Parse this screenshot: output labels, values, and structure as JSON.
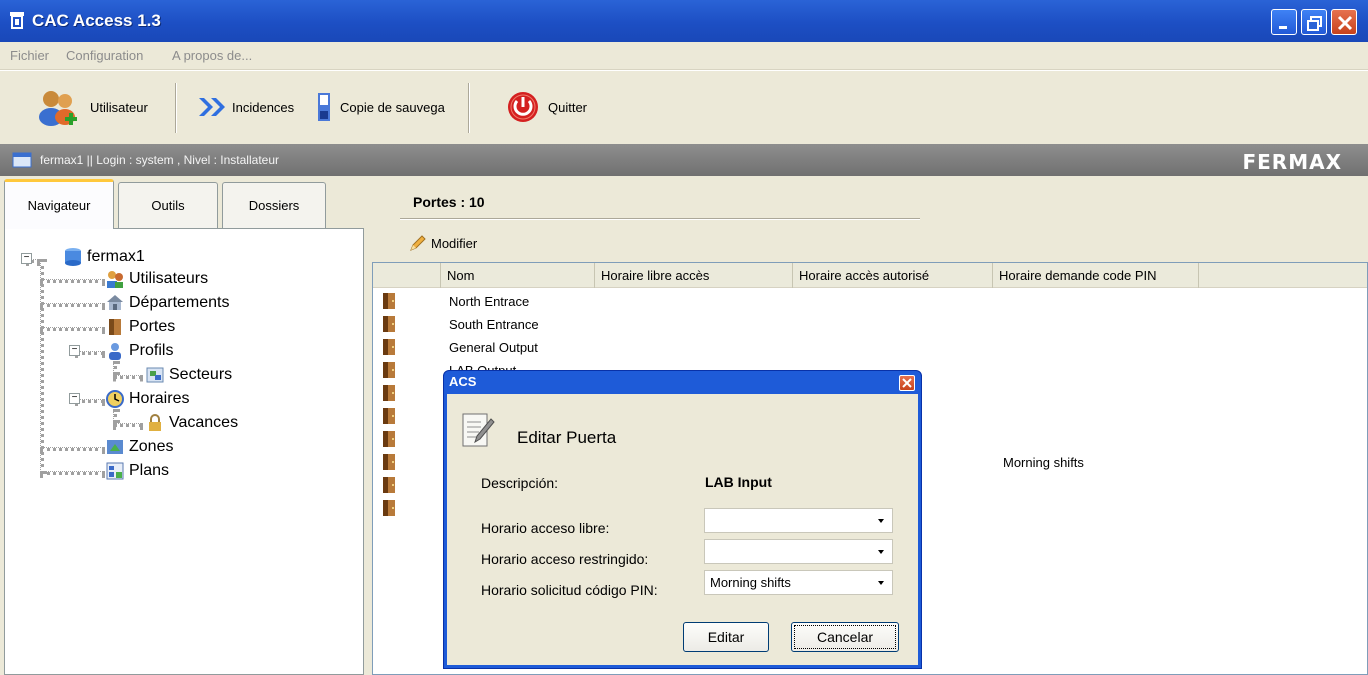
{
  "window": {
    "title": "CAC Access 1.3"
  },
  "menu": [
    "Fichier",
    "Configuration",
    "A propos de..."
  ],
  "toolbar": {
    "utilisateur": "Utilisateur",
    "incidences": "Incidences",
    "copie": "Copie de sauvega",
    "quitter": "Quitter"
  },
  "infobar": {
    "text": "fermax1  || Login : system , Nivel : Installateur",
    "brand": "FERMAX"
  },
  "tabs": [
    "Navigateur",
    "Outils",
    "Dossiers"
  ],
  "tree": {
    "root": "fermax1",
    "utilisateurs": "Utilisateurs",
    "departements": "Départements",
    "portes": "Portes",
    "profils": "Profils",
    "secteurs": "Secteurs",
    "horaires": "Horaires",
    "vacances": "Vacances",
    "zones": "Zones",
    "plans": "Plans"
  },
  "main": {
    "title": "Portes : 10",
    "modifier": "Modifier",
    "columns": [
      "Nom",
      "Horaire libre accès",
      "Horaire accès autorisé",
      "Horaire demande code PIN"
    ],
    "rows": [
      {
        "name": "North Entrace",
        "pin": ""
      },
      {
        "name": "South Entrance",
        "pin": ""
      },
      {
        "name": "General Output",
        "pin": ""
      },
      {
        "name": "LAB Output",
        "pin": ""
      },
      {
        "name": "",
        "pin": ""
      },
      {
        "name": "",
        "pin": ""
      },
      {
        "name": "",
        "pin": ""
      },
      {
        "name": "",
        "pin": "Morning shifts"
      },
      {
        "name": "",
        "pin": ""
      },
      {
        "name": "",
        "pin": ""
      }
    ]
  },
  "dialog": {
    "title": "ACS",
    "heading": "Editar Puerta",
    "desc_label": "Descripción:",
    "desc_value": "LAB Input",
    "libre_label": "Horario acceso libre:",
    "libre_value": "",
    "restr_label": "Horario acceso restringido:",
    "restr_value": "",
    "pin_label": "Horario solicitud código PIN:",
    "pin_value": "Morning shifts",
    "edit_button": "Editar",
    "cancel_button": "Cancelar"
  }
}
